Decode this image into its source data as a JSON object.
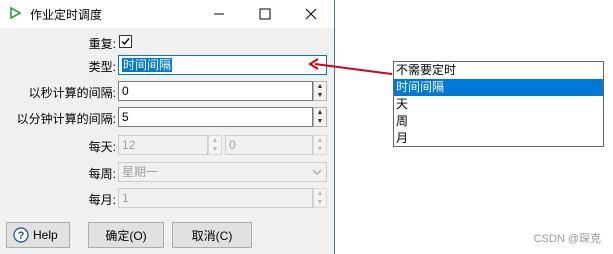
{
  "window": {
    "title": "作业定时调度"
  },
  "form": {
    "repeat_label": "重复:",
    "type_label": "类型:",
    "type_value": "时间间隔",
    "seconds_label": "以秒计算的间隔:",
    "seconds_value": "0",
    "minutes_label": "以分钟计算的间隔:",
    "minutes_value": "5",
    "daily_label": "每天:",
    "daily_hour": "12",
    "daily_minute": "0",
    "weekly_label": "每周:",
    "weekly_value": "星期一",
    "monthly_label": "每月:",
    "monthly_value": "1"
  },
  "buttons": {
    "help": "Help",
    "ok": "确定(O)",
    "cancel": "取消(C)"
  },
  "dropdown": {
    "options": [
      "不需要定时",
      "时间间隔",
      "天",
      "周",
      "月"
    ],
    "selected": "时间间隔"
  },
  "watermark": "CSDN @琛克",
  "colors": {
    "accent": "#0078d7",
    "arrow": "#d0021b",
    "title_icon": "#2ea043"
  },
  "icons": [
    "play-icon",
    "minimize-icon",
    "maximize-icon",
    "close-icon",
    "check-icon",
    "help-icon",
    "spin-up-icon",
    "spin-down-icon",
    "chevron-down-icon"
  ]
}
